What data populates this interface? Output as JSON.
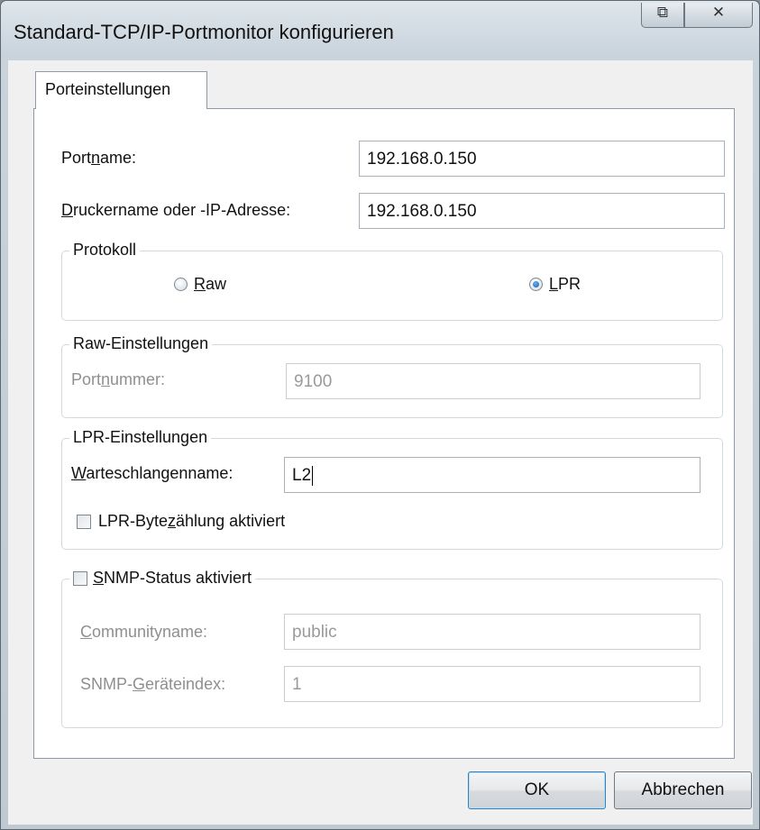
{
  "window": {
    "title": "Standard-TCP/IP-Portmonitor konfigurieren",
    "restore_glyph": "⧉",
    "close_glyph": "✕"
  },
  "tab": {
    "label": "Porteinstellungen"
  },
  "port_name": {
    "label_a": "Port",
    "label_u": "n",
    "label_b": "ame:",
    "value": "192.168.0.150"
  },
  "printer_name": {
    "label_u": "D",
    "label_b": "ruckername oder -IP-Adresse:",
    "value": "192.168.0.150"
  },
  "protocol": {
    "legend": "Protokoll",
    "raw": {
      "label_u": "R",
      "label_b": "aw",
      "selected": false
    },
    "lpr": {
      "label_u": "L",
      "label_b": "PR",
      "selected": true
    }
  },
  "raw_settings": {
    "legend": "Raw-Einstellungen",
    "port_number_label_a": "Port",
    "port_number_label_u": "n",
    "port_number_label_b": "ummer:",
    "port_number_value": "9100"
  },
  "lpr_settings": {
    "legend": "LPR-Einstellungen",
    "queue_label_u": "W",
    "queue_label_b": "arteschlangenname:",
    "queue_value": "L2",
    "bytecount_label_a": "LPR-Byte",
    "bytecount_label_u": "z",
    "bytecount_label_b": "ählung aktiviert",
    "bytecount_checked": false
  },
  "snmp": {
    "legend_u": "S",
    "legend_b": "NMP-Status aktiviert",
    "enabled": false,
    "community_label_u": "C",
    "community_label_b": "ommunityname:",
    "community_value": "public",
    "index_label_a": "SNMP-",
    "index_label_u": "G",
    "index_label_b": "eräteindex:",
    "index_value": "1"
  },
  "buttons": {
    "ok": "OK",
    "cancel": "Abbrechen"
  }
}
